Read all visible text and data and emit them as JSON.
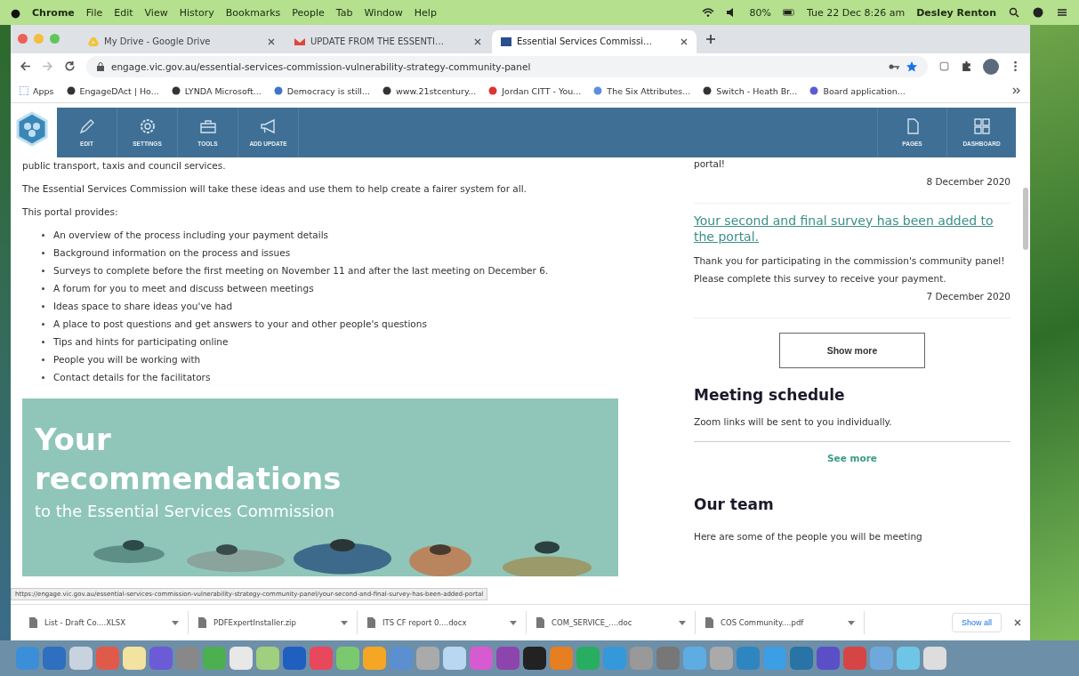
{
  "menubar": {
    "app": "Chrome",
    "items": [
      "File",
      "Edit",
      "View",
      "History",
      "Bookmarks",
      "People",
      "Tab",
      "Window",
      "Help"
    ],
    "battery": "80%",
    "clock": "Tue 22 Dec  8:26 am",
    "user": "Desley Renton"
  },
  "browser": {
    "tabs": [
      {
        "title": "My Drive - Google Drive",
        "selected": false,
        "kind": "drive"
      },
      {
        "title": "UPDATE FROM THE ESSENTI…",
        "selected": false,
        "kind": "mail"
      },
      {
        "title": "Essential Services Commissi…",
        "selected": true,
        "kind": "site"
      }
    ],
    "address": "engage.vic.gov.au/essential-services-commission-vulnerability-strategy-community-panel",
    "bookmarks": [
      "Apps",
      "EngageDAct | Ho...",
      "LYNDA Microsoft...",
      "Democracy is still...",
      "www.21stcentury...",
      "Jordan CITT - You...",
      "The Six Attributes...",
      "Switch - Heath Br...",
      "Board application..."
    ]
  },
  "admin_toolbar": {
    "left_tools": [
      {
        "label": "EDIT",
        "kind": "pencil"
      },
      {
        "label": "SETTINGS",
        "kind": "gear"
      },
      {
        "label": "TOOLS",
        "kind": "toolbox"
      },
      {
        "label": "ADD UPDATE",
        "kind": "megaphone"
      }
    ],
    "right_tools": [
      {
        "label": "PAGES",
        "kind": "page"
      },
      {
        "label": "DASHBOARD",
        "kind": "grid"
      }
    ]
  },
  "content": {
    "intro_tail": "public transport, taxis and council services.",
    "paragraph": "The Essential Services Commission will take these ideas and use them to help create a fairer system for all.",
    "provides_label": "This portal provides:",
    "bullets": [
      "An overview of the process including your payment details",
      "Background information on the process and issues",
      "Surveys to complete before the first meeting on November 11 and after the last meeting on December 6.",
      "A forum for you to meet and discuss between meetings",
      "Ideas space to share ideas you've had",
      "A place to post questions and get answers to your and other people's questions",
      "Tips and hints for participating online",
      "People you will be working with",
      "Contact details for the facilitators"
    ],
    "banner": {
      "title": "Your recommendations",
      "subtitle": "to the Essential Services Commission"
    }
  },
  "sidebar": {
    "updates": [
      {
        "body": "portal!",
        "date": "8 December 2020"
      },
      {
        "title": "Your second and final survey has been added to the portal.",
        "body": "Thank you for participating in the commission's community panel! Please complete this survey to receive your payment.",
        "date": "7 December 2020"
      }
    ],
    "show_more": "Show more",
    "meeting": {
      "heading": "Meeting schedule",
      "text": "Zoom links will be sent to you individually.",
      "link": "See more"
    },
    "team": {
      "heading": "Our team",
      "text": "Here are some of the people you will be meeting"
    }
  },
  "status_url": "https://engage.vic.gov.au/essential-services-commission-vulnerability-strategy-community-panel/your-second-and-final-survey-has-been-added-portal",
  "downloads": {
    "items": [
      "List - Draft Co....XLSX",
      "PDFExpertInstaller.zip",
      "ITS CF report 0....docx",
      "COM_SERVICE_....doc",
      "COS Community....pdf"
    ],
    "show_all": "Show all"
  }
}
